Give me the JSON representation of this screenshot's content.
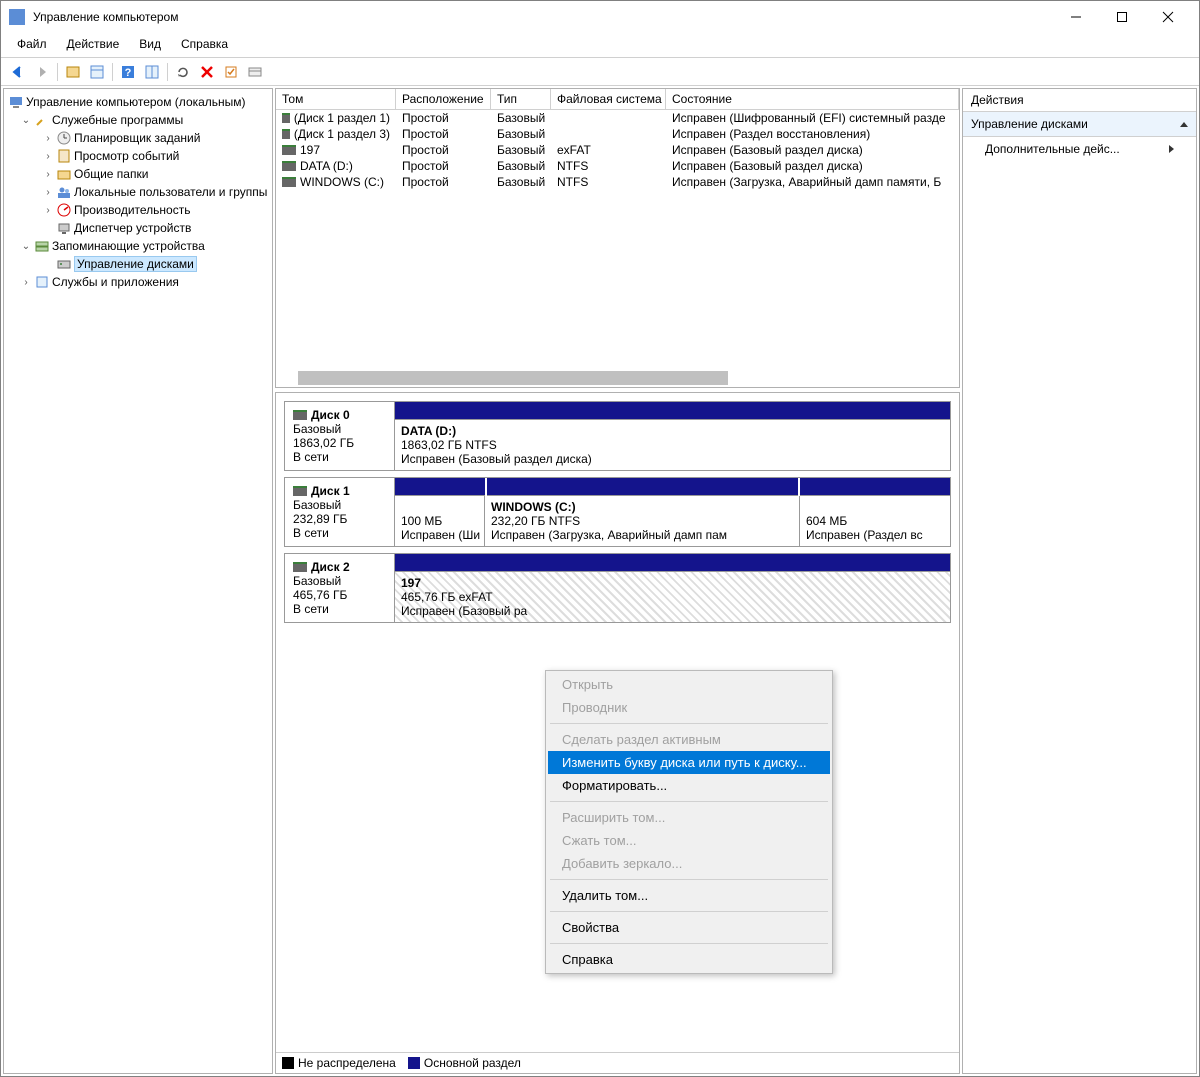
{
  "window": {
    "title": "Управление компьютером"
  },
  "menu": {
    "file": "Файл",
    "action": "Действие",
    "view": "Вид",
    "help": "Справка"
  },
  "tree": {
    "root": "Управление компьютером (локальным)",
    "system_tools": "Служебные программы",
    "task_scheduler": "Планировщик заданий",
    "event_viewer": "Просмотр событий",
    "shared_folders": "Общие папки",
    "local_users": "Локальные пользователи и группы",
    "performance": "Производительность",
    "device_manager": "Диспетчер устройств",
    "storage": "Запоминающие устройства",
    "disk_mgmt": "Управление дисками",
    "services_apps": "Службы и приложения"
  },
  "list": {
    "headers": {
      "volume": "Том",
      "layout": "Расположение",
      "type": "Тип",
      "fs": "Файловая система",
      "status": "Состояние"
    },
    "rows": [
      {
        "volume": "(Диск 1 раздел 1)",
        "layout": "Простой",
        "type": "Базовый",
        "fs": "",
        "status": "Исправен (Шифрованный (EFI) системный разде"
      },
      {
        "volume": "(Диск 1 раздел 3)",
        "layout": "Простой",
        "type": "Базовый",
        "fs": "",
        "status": "Исправен (Раздел восстановления)"
      },
      {
        "volume": "197",
        "layout": "Простой",
        "type": "Базовый",
        "fs": "exFAT",
        "status": "Исправен (Базовый раздел диска)"
      },
      {
        "volume": "DATA (D:)",
        "layout": "Простой",
        "type": "Базовый",
        "fs": "NTFS",
        "status": "Исправен (Базовый раздел диска)"
      },
      {
        "volume": "WINDOWS (C:)",
        "layout": "Простой",
        "type": "Базовый",
        "fs": "NTFS",
        "status": "Исправен (Загрузка, Аварийный дамп памяти, Б"
      }
    ]
  },
  "disks": {
    "d0": {
      "title": "Диск 0",
      "type": "Базовый",
      "size": "1863,02 ГБ",
      "state": "В сети",
      "p0": {
        "name": "DATA  (D:)",
        "size": "1863,02 ГБ NTFS",
        "status": "Исправен (Базовый раздел диска)"
      }
    },
    "d1": {
      "title": "Диск 1",
      "type": "Базовый",
      "size": "232,89 ГБ",
      "state": "В сети",
      "p0": {
        "size": "100 МБ",
        "status": "Исправен (Ши"
      },
      "p1": {
        "name": "WINDOWS  (C:)",
        "size": "232,20 ГБ NTFS",
        "status": "Исправен (Загрузка, Аварийный дамп пам"
      },
      "p2": {
        "size": "604 МБ",
        "status": "Исправен (Раздел вс"
      }
    },
    "d2": {
      "title": "Диск 2",
      "type": "Базовый",
      "size": "465,76 ГБ",
      "state": "В сети",
      "p0": {
        "name": "197",
        "size": "465,76 ГБ exFAT",
        "status": "Исправен (Базовый ра"
      }
    }
  },
  "legend": {
    "unalloc": "Не распределена",
    "primary": "Основной раздел"
  },
  "actions": {
    "title": "Действия",
    "section": "Управление дисками",
    "more": "Дополнительные дейс..."
  },
  "ctx": {
    "open": "Открыть",
    "explorer": "Проводник",
    "active": "Сделать раздел активным",
    "change_letter": "Изменить букву диска или путь к диску...",
    "format": "Форматировать...",
    "extend": "Расширить том...",
    "shrink": "Сжать том...",
    "mirror": "Добавить зеркало...",
    "delete": "Удалить том...",
    "props": "Свойства",
    "help": "Справка"
  }
}
